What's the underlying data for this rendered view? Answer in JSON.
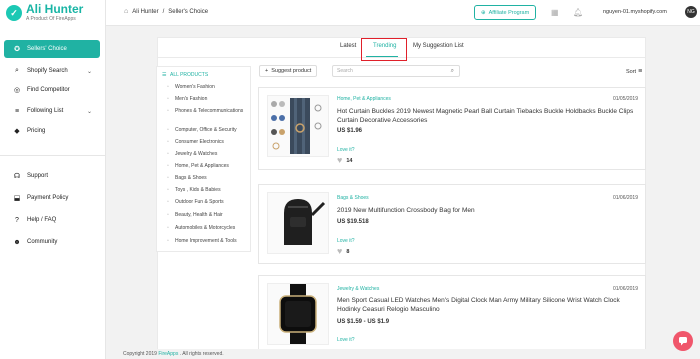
{
  "app": {
    "name": "Ali Hunter",
    "subtitle": "A Product Of FireApps"
  },
  "sidebar": {
    "main_items": [
      {
        "label": "Sellers' Choice",
        "icon": "star-circle-icon",
        "active": true
      },
      {
        "label": "Shopify Search",
        "icon": "search-icon",
        "chevron": "⌄"
      },
      {
        "label": "Find Competitor",
        "icon": "target-icon"
      },
      {
        "label": "Following List",
        "icon": "list-icon",
        "chevron": "⌄"
      },
      {
        "label": "Pricing",
        "icon": "tag-icon"
      }
    ],
    "support_items": [
      {
        "label": "Support",
        "icon": "headset-icon"
      },
      {
        "label": "Payment Policy",
        "icon": "payment-icon"
      },
      {
        "label": "Help / FAQ",
        "icon": "help-icon"
      },
      {
        "label": "Community",
        "icon": "community-icon"
      }
    ]
  },
  "topbar": {
    "breadcrumb": [
      "Ali Hunter",
      "/",
      "Seller's Choice"
    ],
    "affiliate_label": "Affiliate Program",
    "store": "nguyen-01.myshopify.com",
    "avatar_initials": "NG"
  },
  "tabs": [
    {
      "label": "Latest",
      "active": false
    },
    {
      "label": "Trending",
      "active": true
    },
    {
      "label": "My Suggestion List",
      "active": false
    }
  ],
  "categories": [
    {
      "label": "ALL PRODUCTS",
      "active": true
    },
    {
      "label": "Women's Fashion"
    },
    {
      "label": "Men's Fashion"
    },
    {
      "label": "Phones & Telecommunications"
    },
    {
      "label": "Computer, Office & Security"
    },
    {
      "label": "Consumer Electronics"
    },
    {
      "label": "Jewelry & Watches"
    },
    {
      "label": "Home, Pet & Appliances"
    },
    {
      "label": "Bags & Shoes"
    },
    {
      "label": "Toys , Kids & Babies"
    },
    {
      "label": "Outdoor Fun & Sports"
    },
    {
      "label": "Beauty, Health & Hair"
    },
    {
      "label": "Automobiles & Motorcycles"
    },
    {
      "label": "Home Improvement & Tools"
    }
  ],
  "toolbar": {
    "suggest_label": "Suggest product",
    "search_placeholder": "Search",
    "sort_label": "Sort"
  },
  "products": [
    {
      "category": "Home, Pet & Appliances",
      "date": "01/05/2019",
      "title": "Hot Curtain Buckles 2019 Newest Magnetic Pearl Ball Curtain Tiebacks Buckle Holdbacks Buckle Clips Curtain Decorative Accessories",
      "price": "US $1.96",
      "love_label": "Love it?",
      "likes": "14"
    },
    {
      "category": "Bags & Shoes",
      "date": "01/06/2019",
      "title": "2019 New Multifunction Crossbody Bag for Men",
      "price": "US $19.518",
      "love_label": "Love it?",
      "likes": "8"
    },
    {
      "category": "Jewelry & Watches",
      "date": "01/06/2019",
      "title": "Men Sport Casual LED Watches Men's Digital Clock Man Army Military Silicone Wrist Watch Clock Hodinky Ceasuri Relogio Masculino",
      "price": "US $1.59 - US $1.9",
      "love_label": "Love it?",
      "likes": ""
    }
  ],
  "footer": {
    "prefix": "Copyright 2019",
    "link": "FireApps",
    "suffix": ". All rights reserved."
  }
}
